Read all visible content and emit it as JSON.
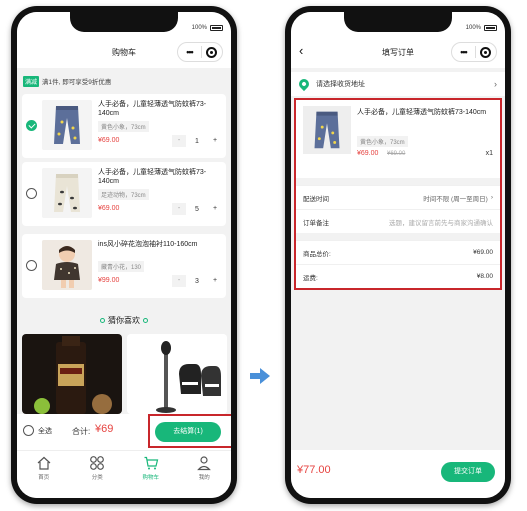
{
  "status": {
    "battery": "100%"
  },
  "cart": {
    "title": "购物车",
    "promo_tag": "满减",
    "promo_text": "满1件, 即可享受9折优惠",
    "items": [
      {
        "title": "人手必备，儿童轻薄透气防蚊裤73-140cm",
        "spec": "黄色小象，73cm",
        "price": "¥69.00",
        "qty": "1",
        "checked": true
      },
      {
        "title": "人手必备，儿童轻薄透气防蚊裤73-140cm",
        "spec": "足迹动物，73cm",
        "price": "¥69.00",
        "qty": "5",
        "checked": false
      },
      {
        "title": "ins风小碎花泡泡袖衬110-160cm",
        "spec": "藏青小花，130",
        "price": "¥99.00",
        "qty": "3",
        "checked": false
      }
    ],
    "minus": "-",
    "plus": "+",
    "guess_title": "猜你喜欢",
    "select_all": "全选",
    "total_label": "合计:",
    "total_value": "¥69",
    "checkout_button": "去结算(1)",
    "tabs": [
      {
        "label": "首页",
        "icon": "home-icon"
      },
      {
        "label": "分类",
        "icon": "category-icon"
      },
      {
        "label": "购物车",
        "icon": "cart-icon"
      },
      {
        "label": "我的",
        "icon": "user-icon"
      }
    ]
  },
  "order": {
    "title": "填写订单",
    "address": "请选择收货地址",
    "item": {
      "title": "人手必备，儿童轻薄透气防蚊裤73-140cm",
      "spec": "黄色小象，73cm",
      "price": "¥69.00",
      "old_price": "¥69.00",
      "qty": "x1"
    },
    "delivery_label": "配送时间",
    "delivery_value": "时间不限 (周一至周日)",
    "note_label": "订单备注",
    "note_placeholder": "选题，建议留言前先与商家沟通确认",
    "goods_total_label": "商品总价:",
    "goods_total_value": "¥69.00",
    "freight_label": "运费:",
    "freight_value": "¥8.00",
    "pay_total": "¥77.00",
    "submit_button": "提交订单"
  },
  "colors": {
    "accent": "#18b77a",
    "price": "#e64340",
    "highlight": "#c8262b",
    "arrow": "#4a90d9"
  }
}
